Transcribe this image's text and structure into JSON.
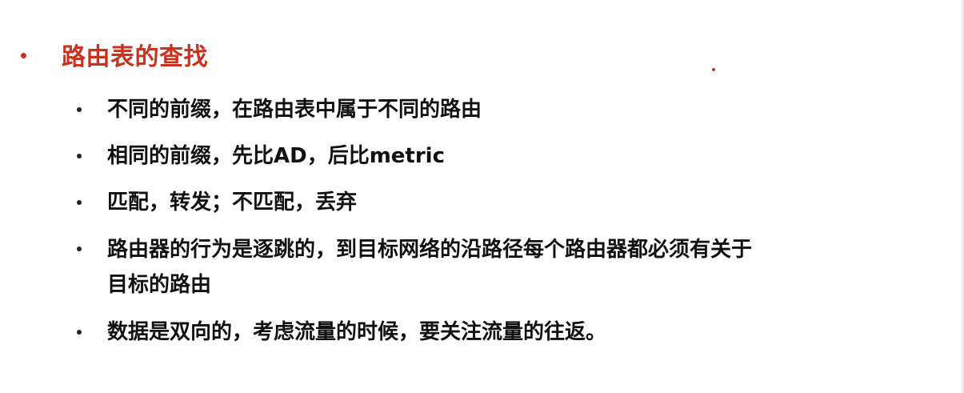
{
  "slide": {
    "title": "路由表的查找",
    "items": [
      {
        "lines": [
          "不同的前缀，在路由表中属于不同的路由"
        ]
      },
      {
        "lines": [
          "相同的前缀，先比AD，后比metric"
        ]
      },
      {
        "lines": [
          "匹配，转发；不匹配，丢弃"
        ]
      },
      {
        "lines": [
          "路由器的行为是逐跳的，到目标网络的沿路径每个路由器都必须有关于",
          "目标的路由"
        ]
      },
      {
        "lines": [
          "数据是双向的，考虑流量的时候，要关注流量的往返。"
        ]
      }
    ]
  },
  "colors": {
    "title": "#c8321e",
    "text": "#111111",
    "background": "#ffffff"
  }
}
